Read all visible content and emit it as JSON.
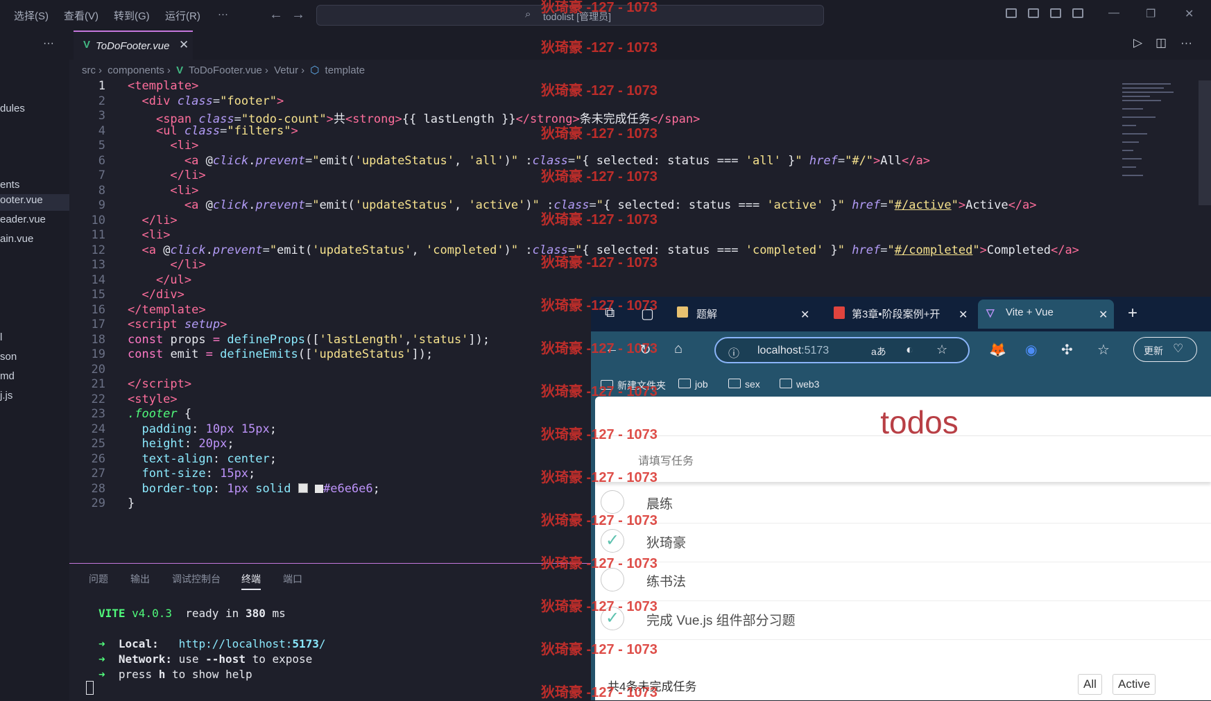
{
  "titlebar": {
    "menu": [
      "选择(S)",
      "查看(V)",
      "转到(G)",
      "运行(R)",
      "···"
    ],
    "search": "todolist [管理员]"
  },
  "explorer": {
    "more": "···",
    "items": [
      "dules",
      "ents",
      "ooter.vue",
      "eader.vue",
      "ain.vue",
      "l",
      "son",
      "md",
      "j.js"
    ]
  },
  "editor": {
    "tab_label": "ToDoFooter.vue",
    "breadcrumb": [
      "src",
      "components",
      "ToDoFooter.vue",
      "Vetur",
      "template"
    ],
    "line_numbers": [
      "1",
      "2",
      "3",
      "4",
      "5",
      "6",
      "7",
      "8",
      "9",
      "10",
      "11",
      "12",
      "13",
      "14",
      "15",
      "16",
      "17",
      "18",
      "19",
      "20",
      "21",
      "22",
      "23",
      "24",
      "25",
      "26",
      "27",
      "28",
      "29"
    ]
  },
  "panel": {
    "tabs": [
      "问题",
      "输出",
      "调试控制台",
      "终端",
      "端口"
    ],
    "active_tab": "终端",
    "vite": "VITE",
    "vite_version": "v4.0.3",
    "ready": "ready in",
    "ms_value": "380",
    "ms_unit": "ms",
    "local_label": "Local:",
    "local_url_prefix": "http://localhost:",
    "local_port": "5173",
    "local_url_suffix": "/",
    "network_label": "Network:",
    "network_a": "use",
    "network_flag": "--host",
    "network_b": "to expose",
    "help_a": "press",
    "help_key": "h",
    "help_b": "to show help"
  },
  "browser": {
    "tabs": [
      "题解",
      "第3章•阶段案例+开",
      "Vite + Vue"
    ],
    "address_host": "localhost",
    "address_port": ":5173",
    "aa_label": "aあ",
    "update_label": "更新",
    "bookmarks": [
      "新建文件夹",
      "job",
      "sex",
      "web3"
    ],
    "app": {
      "title": "todos",
      "placeholder": "请填写任务",
      "todos": [
        {
          "text": "晨练",
          "done": false
        },
        {
          "text": "狄琦豪",
          "done": true
        },
        {
          "text": "练书法",
          "done": false
        },
        {
          "text": "完成 Vue.js 组件部分习题",
          "done": true
        }
      ],
      "count_text": "共4条未完成任务",
      "filters": [
        "All",
        "Active"
      ]
    }
  },
  "watermark": "狄琦豪 -127 - 1073",
  "colors": {
    "accent": "#c678dd",
    "vue": "#42b883",
    "todos_red": "#b83f45"
  }
}
